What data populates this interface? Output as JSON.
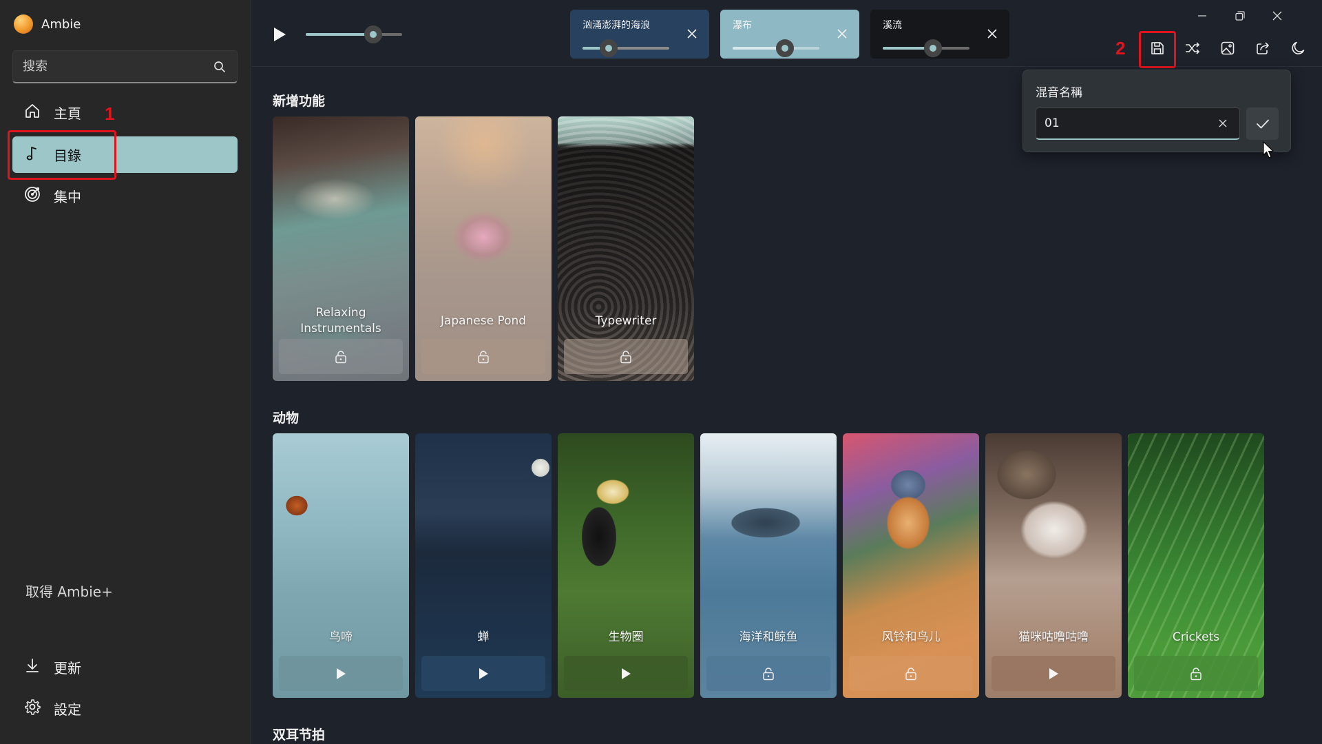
{
  "app": {
    "name": "Ambie"
  },
  "sidebar": {
    "search_placeholder": "搜索",
    "items": [
      {
        "label": "主頁",
        "icon": "home-icon"
      },
      {
        "label": "目錄",
        "icon": "music-note-icon",
        "active": true
      },
      {
        "label": "集中",
        "icon": "focus-target-icon"
      }
    ],
    "get_plus": "取得 Ambie+",
    "bottom_items": [
      {
        "label": "更新",
        "icon": "download-icon"
      },
      {
        "label": "設定",
        "icon": "gear-icon"
      }
    ],
    "annotation_1": "1"
  },
  "player": {
    "master_volume": 0.7,
    "active_sounds": [
      {
        "name": "汹涌澎湃的海浪",
        "volume": 0.3,
        "bg": "#27415e"
      },
      {
        "name": "瀑布",
        "volume": 0.6,
        "bg": "#8eb8c4"
      },
      {
        "name": "溪流",
        "volume": 0.58,
        "bg": "#15171a"
      }
    ]
  },
  "toolbar": {
    "annotation_2": "2",
    "buttons": [
      "save-icon",
      "shuffle-icon",
      "image-icon",
      "share-icon",
      "moon-icon"
    ]
  },
  "save_popup": {
    "label": "混音名稱",
    "value": "01"
  },
  "sections": [
    {
      "title": "新增功能",
      "cards": [
        {
          "name": "Relaxing Instrumentals",
          "action": "unlock"
        },
        {
          "name": "Japanese Pond",
          "action": "unlock"
        },
        {
          "name": "Typewriter",
          "action": "unlock"
        }
      ]
    },
    {
      "title": "动物",
      "cards": [
        {
          "name": "鸟啼",
          "action": "play"
        },
        {
          "name": "蝉",
          "action": "play"
        },
        {
          "name": "生物圈",
          "action": "play"
        },
        {
          "name": "海洋和鲸鱼",
          "action": "unlock"
        },
        {
          "name": "风铃和鸟儿",
          "action": "unlock"
        },
        {
          "name": "猫咪咕噜咕噜",
          "action": "play"
        },
        {
          "name": "Crickets",
          "action": "unlock"
        }
      ]
    },
    {
      "title": "双耳节拍"
    }
  ],
  "colors": {
    "accent": "#9dc6c9",
    "annotation": "#e0141e"
  }
}
